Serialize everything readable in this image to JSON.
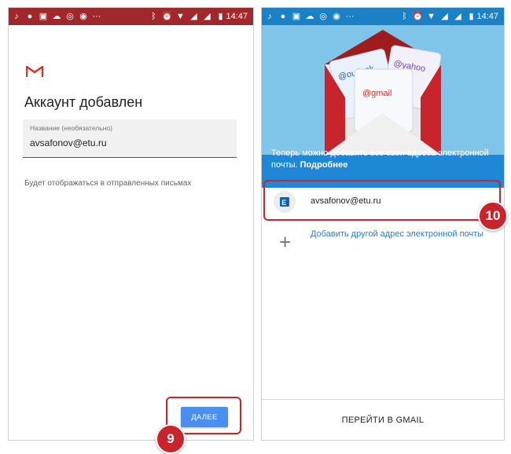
{
  "status_bar": {
    "time": "14:47",
    "dots": "···"
  },
  "left_screen": {
    "title": "Аккаунт добавлен",
    "name_field": {
      "label": "Название (необязательно)",
      "value": "avsafonov@etu.ru"
    },
    "hint": "Будет отображаться в отправленных письмах",
    "next_button": "ДАЛЕЕ",
    "step_badge": "9"
  },
  "right_screen": {
    "hero_labels": {
      "outlook": "@outlook",
      "yahoo": "@yahoo",
      "gmail": "@gmail"
    },
    "banner_text": "Теперь можно добавить все свои адреса электронной почты.",
    "banner_link": "Подробнее",
    "account_email": "avsafonov@etu.ru",
    "add_account": "Добавить другой адрес электронной почты",
    "goto_button": "ПЕРЕЙТИ В GMAIL",
    "step_badge": "10"
  },
  "colors": {
    "gmail_red": "#c8242b",
    "accent_blue": "#1e88d6",
    "button_blue": "#4a8ff0"
  }
}
